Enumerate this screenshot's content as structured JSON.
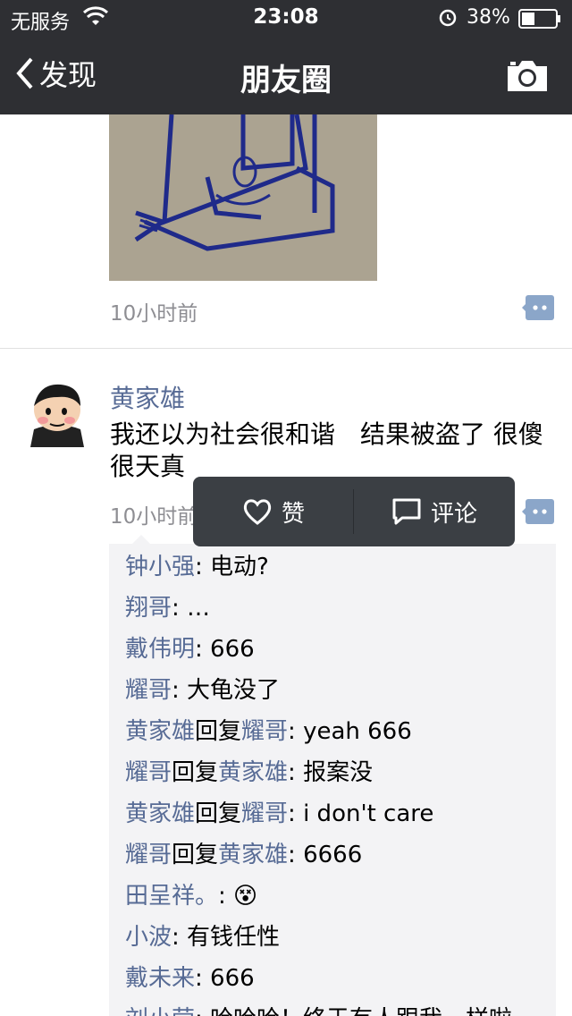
{
  "status_bar": {
    "carrier": "无服务",
    "time": "23:08",
    "battery_percent": "38%",
    "battery_level": 0.38
  },
  "nav": {
    "back_label": "发现",
    "title": "朋友圈"
  },
  "post1": {
    "time": "10小时前"
  },
  "post2": {
    "author": "黄家雄",
    "text": "我还以为社会很和谐　结果被盗了  很傻很天真",
    "time": "10小时前"
  },
  "action_popup": {
    "like_label": "赞",
    "comment_label": "评论"
  },
  "comments": [
    {
      "name": "钟小强",
      "reply_word": "",
      "reply_to": "",
      "text": ": 电动?"
    },
    {
      "name": "翔哥",
      "reply_word": "",
      "reply_to": "",
      "text": ": …"
    },
    {
      "name": "戴伟明",
      "reply_word": "",
      "reply_to": "",
      "text": ": 666"
    },
    {
      "name": "耀哥",
      "reply_word": "",
      "reply_to": "",
      "text": ": 大龟没了"
    },
    {
      "name": "黄家雄",
      "reply_word": "回复",
      "reply_to": "耀哥",
      "text": ": yeah   666"
    },
    {
      "name": "耀哥",
      "reply_word": "回复",
      "reply_to": "黄家雄",
      "text": ": 报案没"
    },
    {
      "name": "黄家雄",
      "reply_word": "回复",
      "reply_to": "耀哥",
      "text": ": i don't care"
    },
    {
      "name": "耀哥",
      "reply_word": "回复",
      "reply_to": "黄家雄",
      "text": ": 6666"
    },
    {
      "name": "田呈祥。",
      "reply_word": "",
      "reply_to": "",
      "text": ": 😵"
    },
    {
      "name": "小波",
      "reply_word": "",
      "reply_to": "",
      "text": ": 有钱任性"
    },
    {
      "name": "戴未来",
      "reply_word": "",
      "reply_to": "",
      "text": ": 666"
    },
    {
      "name": "刘小莹",
      "reply_word": "",
      "reply_to": "",
      "text": ": 哈哈哈！终于有人跟我一样啦"
    }
  ],
  "colors": {
    "link_blue": "#576b95",
    "bar_bg": "#2e2f33",
    "popup_bg": "#3b3f44",
    "comment_bg": "#f3f3f5"
  }
}
